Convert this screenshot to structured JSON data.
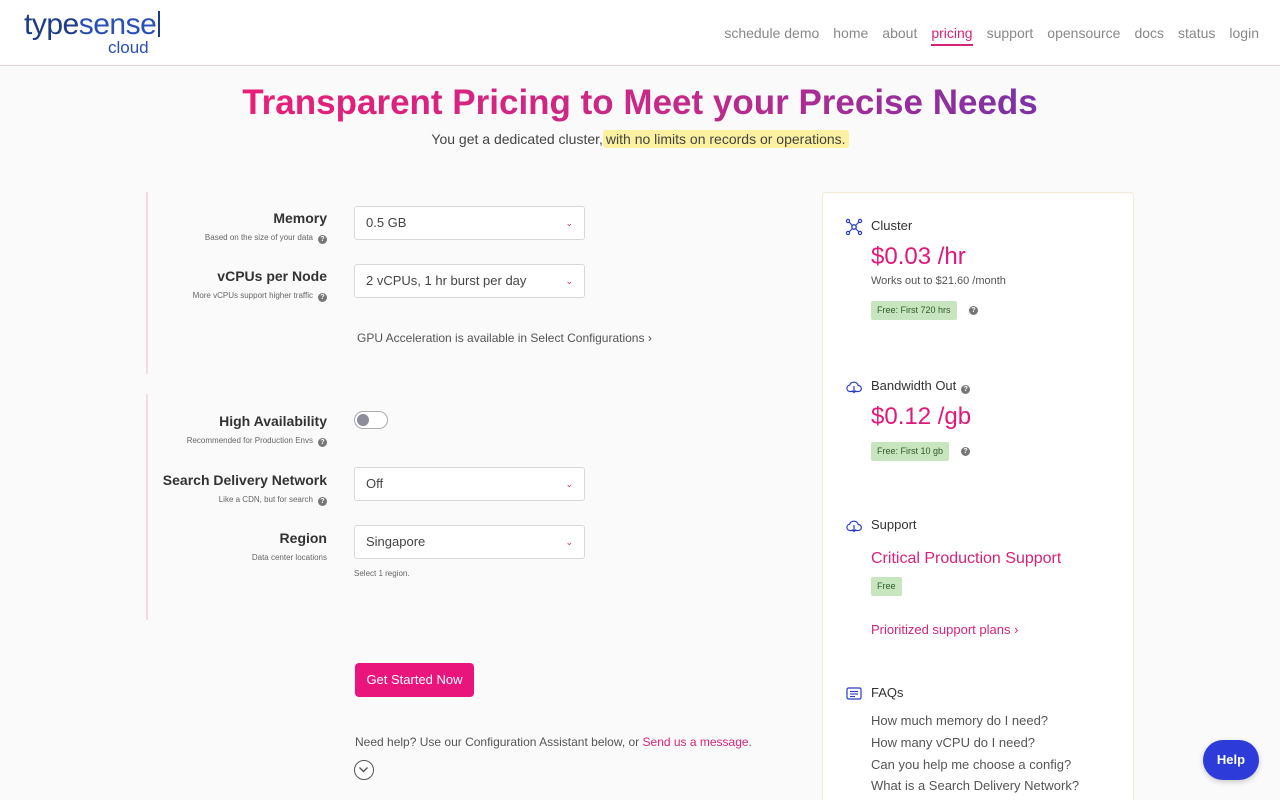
{
  "logo": {
    "type_a": "type",
    "type_b": "sense",
    "sub": "cloud"
  },
  "nav": [
    {
      "label": "schedule demo",
      "active": false
    },
    {
      "label": "home",
      "active": false
    },
    {
      "label": "about",
      "active": false
    },
    {
      "label": "pricing",
      "active": true
    },
    {
      "label": "support",
      "active": false
    },
    {
      "label": "opensource",
      "active": false
    },
    {
      "label": "docs",
      "active": false
    },
    {
      "label": "status",
      "active": false
    },
    {
      "label": "login",
      "active": false
    }
  ],
  "hero": {
    "title": "Transparent Pricing to Meet your Precise Needs",
    "subtitle_plain": "You get a dedicated cluster,",
    "subtitle_highlight": "with no limits on records or operations."
  },
  "form": {
    "memory": {
      "label": "Memory",
      "desc": "Based on the size of your data",
      "value": "0.5 GB"
    },
    "vcpu": {
      "label": "vCPUs per Node",
      "desc": "More vCPUs support higher traffic",
      "value": "2 vCPUs, 1 hr burst per day"
    },
    "gpu_link": "GPU Acceleration is available in Select Configurations ›",
    "ha": {
      "label": "High Availability",
      "desc": "Recommended for Production Envs",
      "enabled": false
    },
    "sdn": {
      "label": "Search Delivery Network",
      "desc": "Like a CDN, but for search",
      "value": "Off"
    },
    "region": {
      "label": "Region",
      "desc": "Data center locations",
      "value": "Singapore",
      "note": "Select 1 region."
    },
    "cta": "Get Started Now",
    "help_prefix": "Need help? Use our Configuration Assistant below, or",
    "help_link": "Send us a message",
    "help_suffix": "."
  },
  "card": {
    "cluster": {
      "title": "Cluster",
      "price": "$0.03 /hr",
      "works": "Works out to $21.60 /month",
      "badge": "Free: First 720 hrs"
    },
    "bandwidth": {
      "title": "Bandwidth Out",
      "price": "$0.12 /gb",
      "badge": "Free: First 10 gb"
    },
    "support": {
      "title": "Support",
      "plan": "Critical Production Support",
      "badge": "Free",
      "link": "Prioritized support plans ›"
    },
    "faqs": {
      "title": "FAQs",
      "items": [
        "How much memory do I need?",
        "How many vCPU do I need?",
        "Can you help me choose a config?",
        "What is a Search Delivery Network?"
      ]
    }
  },
  "help_button": "Help",
  "colors": {
    "accent": "#d6237a",
    "cta": "#ea147d",
    "badge_bg": "#c7e6c0",
    "help_button": "#2d3cd9",
    "logo_blue": "#1e3a8a"
  }
}
